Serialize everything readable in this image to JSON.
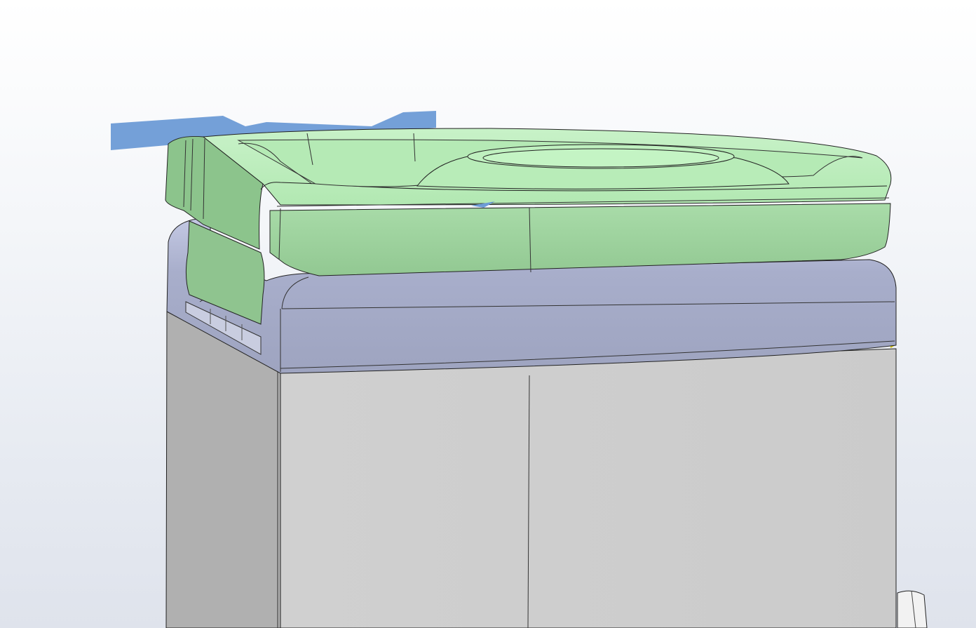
{
  "viewport": {
    "background_top": "#ffffff",
    "background_bottom": "#dfe3ec"
  },
  "model": {
    "parts": [
      {
        "name": "container-body",
        "color": "#cdcdcd",
        "shade_color": "#b0b0b0"
      },
      {
        "name": "collar-band",
        "color": "#a3a9c4",
        "highlight_color": "#c3c8e2"
      },
      {
        "name": "lid",
        "color": "#9fd19f",
        "highlight_color": "#bff0bf"
      },
      {
        "name": "section-plane",
        "color": "#6d9bd6"
      }
    ],
    "edge_color": "#1a1a1a",
    "selected_edge_color": "#d4c200"
  }
}
